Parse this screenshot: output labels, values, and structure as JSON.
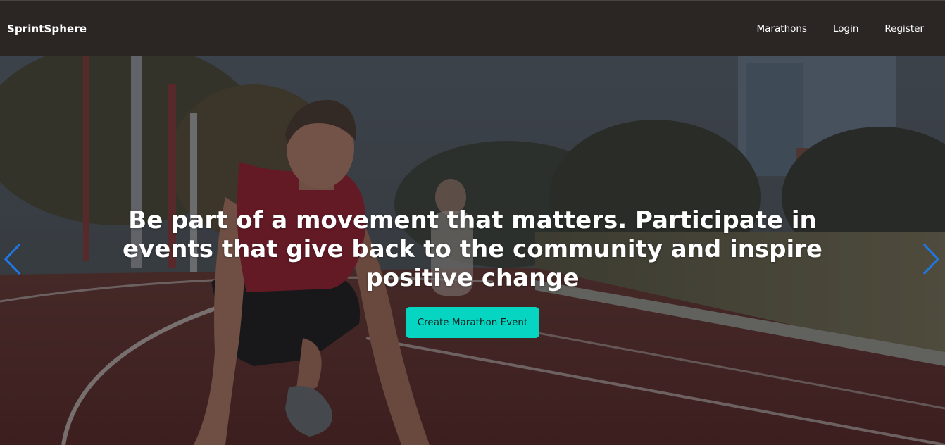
{
  "navbar": {
    "brand": "SprintSphere",
    "links": [
      "Marathons",
      "Login",
      "Register"
    ]
  },
  "hero": {
    "heading": "Be part of a movement that matters. Participate in events that give back to the community and inspire positive change",
    "cta_label": "Create Marathon Event",
    "prev_icon": "chevron-left-icon",
    "next_icon": "chevron-right-icon"
  },
  "colors": {
    "navbar_bg": "#2b2624",
    "cta_bg": "#06d6c1",
    "arrow": "#1e78e6",
    "track": "#6b2f2a"
  }
}
